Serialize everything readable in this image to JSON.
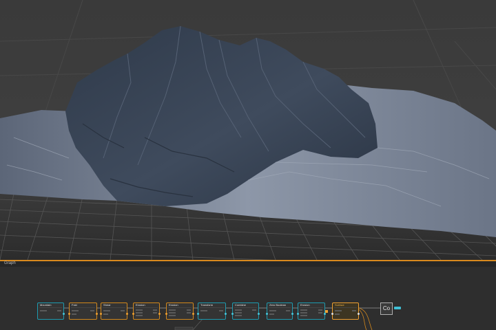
{
  "viewport": {
    "colors": {
      "background": "#3d3d3d",
      "grid": "#4d4d4d",
      "terrain_dark": "#3a4658",
      "terrain_light": "#8e98a8"
    }
  },
  "graph_panel": {
    "label": "Graph",
    "accent_color": "#d98a1e"
  },
  "nodes": [
    {
      "title": "Mountain",
      "kind": "teal"
    },
    {
      "title": "Fold",
      "kind": "orange"
    },
    {
      "title": "Shear",
      "kind": "orange"
    },
    {
      "title": "Erosion",
      "kind": "orange"
    },
    {
      "title": "Erosion",
      "kind": "orange"
    },
    {
      "title": "Transform",
      "kind": "teal"
    },
    {
      "title": "Combine",
      "kind": "teal"
    },
    {
      "title": "Zero Boolean",
      "kind": "teal"
    },
    {
      "title": "Erosion",
      "kind": "teal"
    },
    {
      "title": "Surface",
      "kind": "active"
    }
  ],
  "output_node": {
    "label": "Co"
  }
}
